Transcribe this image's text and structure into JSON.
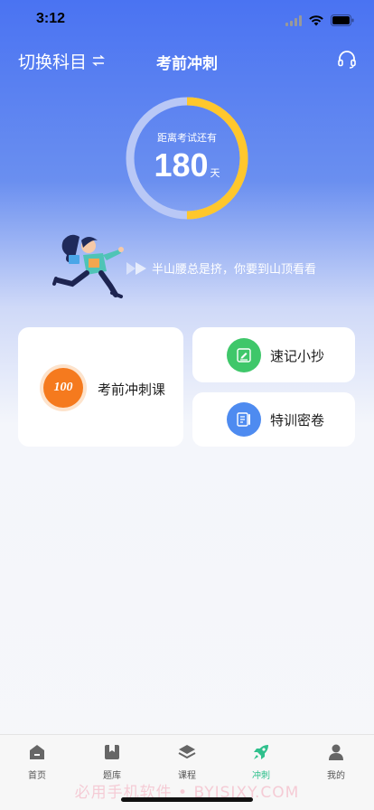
{
  "status_bar": {
    "time": "3:12"
  },
  "nav": {
    "subject_switch_label": "切换科目",
    "title": "考前冲刺",
    "support_icon": "headset-icon"
  },
  "countdown": {
    "label": "距离考试还有",
    "days": "180",
    "unit": "天",
    "ring_progress": 0.5,
    "ring_color": "#ffc72c",
    "ring_track_color": "#b9c8f6"
  },
  "slogan": "半山腰总是挤，你要到山顶看看",
  "cards": {
    "main": {
      "label": "考前冲刺课",
      "icon_text": "100",
      "icon_color": "#f57a1e"
    },
    "notes": {
      "label": "速记小抄",
      "icon_color": "#3fc76a"
    },
    "papers": {
      "label": "特训密卷",
      "icon_color": "#4e8bf0"
    }
  },
  "tabs": [
    {
      "label": "首页",
      "icon": "home-icon"
    },
    {
      "label": "题库",
      "icon": "question-bank-icon"
    },
    {
      "label": "课程",
      "icon": "layers-icon"
    },
    {
      "label": "冲刺",
      "icon": "rocket-icon",
      "active": true
    },
    {
      "label": "我的",
      "icon": "user-icon"
    }
  ],
  "watermark": "必用手机软件 • BYISJXY.COM",
  "colors": {
    "accent": "#2fc08c",
    "primary_blue": "#4a73f2"
  }
}
